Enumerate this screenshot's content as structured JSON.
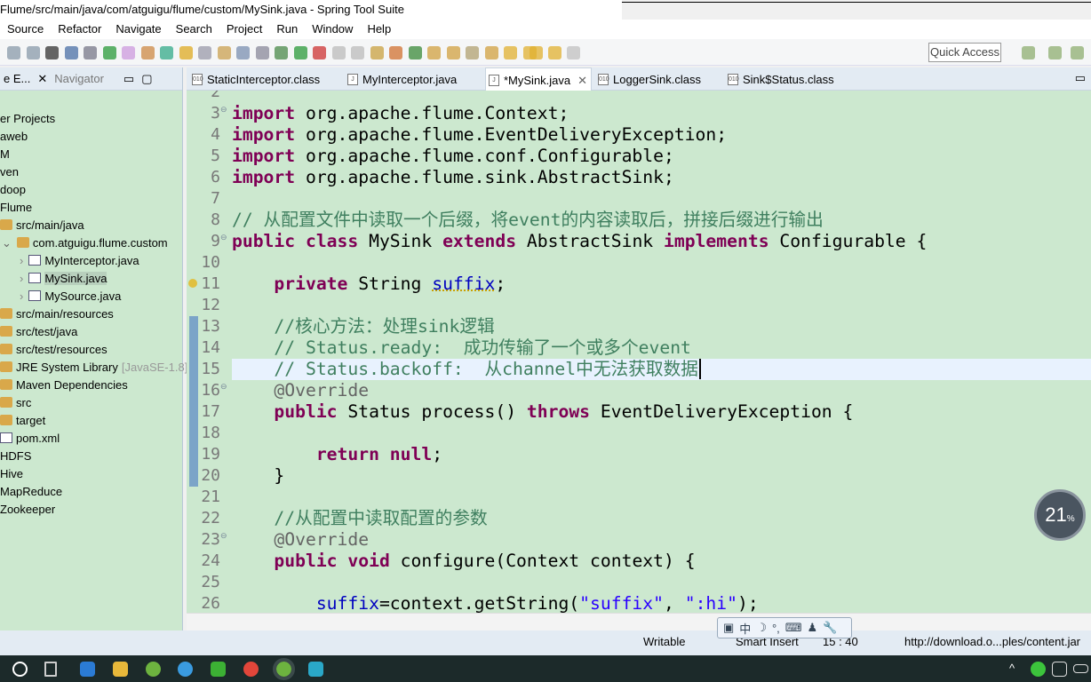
{
  "window": {
    "title": "Flume/src/main/java/com/atguigu/flume/custom/MySink.java - Spring Tool Suite"
  },
  "menu": [
    "Source",
    "Refactor",
    "Navigate",
    "Search",
    "Project",
    "Run",
    "Window",
    "Help"
  ],
  "toolbar": {
    "quick_access": "Quick Access"
  },
  "left_panel": {
    "tabs": [
      "e E...",
      "Navigator"
    ],
    "tree": [
      {
        "label": "er Projects",
        "indent": 0
      },
      {
        "label": "aweb",
        "indent": 0
      },
      {
        "label": "M",
        "indent": 0
      },
      {
        "label": "ven",
        "indent": 0
      },
      {
        "label": "doop",
        "indent": 0
      },
      {
        "label": "Flume",
        "indent": 0
      },
      {
        "label": "src/main/java",
        "indent": 1,
        "icon": "package-folder-icon"
      },
      {
        "label": "com.atguigu.flume.custom",
        "indent": 2,
        "icon": "package-icon",
        "expanded": true
      },
      {
        "label": "MyInterceptor.java",
        "indent": 3,
        "icon": "java-file-icon"
      },
      {
        "label": "MySink.java",
        "indent": 3,
        "icon": "java-file-warning-icon",
        "selected": true
      },
      {
        "label": "MySource.java",
        "indent": 3,
        "icon": "java-file-icon"
      },
      {
        "label": "src/main/resources",
        "indent": 1,
        "icon": "package-folder-icon"
      },
      {
        "label": "src/test/java",
        "indent": 1,
        "icon": "package-folder-icon"
      },
      {
        "label": "src/test/resources",
        "indent": 1,
        "icon": "package-folder-icon"
      },
      {
        "label": "JRE System Library",
        "suffix": "[JavaSE-1.8]",
        "indent": 1,
        "icon": "library-icon"
      },
      {
        "label": "Maven Dependencies",
        "indent": 1,
        "icon": "library-icon"
      },
      {
        "label": "src",
        "indent": 1,
        "icon": "folder-icon"
      },
      {
        "label": "target",
        "indent": 1,
        "icon": "folder-icon"
      },
      {
        "label": "pom.xml",
        "indent": 1,
        "icon": "maven-file-icon"
      },
      {
        "label": "HDFS",
        "indent": 0
      },
      {
        "label": "Hive",
        "indent": 0
      },
      {
        "label": "MapReduce",
        "indent": 0
      },
      {
        "label": "Zookeeper",
        "indent": 0
      }
    ]
  },
  "editor_tabs": [
    {
      "label": "StaticInterceptor.class",
      "icon": "class-file-icon"
    },
    {
      "label": "MyInterceptor.java",
      "icon": "java-file-icon"
    },
    {
      "label": "*MySink.java",
      "icon": "java-file-icon",
      "active": true
    },
    {
      "label": "LoggerSink.class",
      "icon": "class-file-icon"
    },
    {
      "label": "Sink$Status.class",
      "icon": "class-file-icon"
    }
  ],
  "editor": {
    "current_line": 15,
    "lines": [
      {
        "n": "2",
        "t": []
      },
      {
        "n": "3",
        "t": [
          [
            "kw",
            "import"
          ],
          [
            "pl",
            " org.apache.flume.Context;"
          ]
        ]
      },
      {
        "n": "4",
        "t": [
          [
            "kw",
            "import"
          ],
          [
            "pl",
            " org.apache.flume.EventDeliveryException;"
          ]
        ]
      },
      {
        "n": "5",
        "t": [
          [
            "kw",
            "import"
          ],
          [
            "pl",
            " org.apache.flume.conf.Configurable;"
          ]
        ]
      },
      {
        "n": "6",
        "t": [
          [
            "kw",
            "import"
          ],
          [
            "pl",
            " org.apache.flume.sink.AbstractSink;"
          ]
        ]
      },
      {
        "n": "7",
        "t": []
      },
      {
        "n": "8",
        "t": [
          [
            "cm",
            "// 从配置文件中读取一个后缀，将event的内容读取后，拼接后缀进行输出"
          ]
        ]
      },
      {
        "n": "9",
        "t": [
          [
            "kw",
            "public class"
          ],
          [
            "pl",
            " MySink "
          ],
          [
            "kw",
            "extends"
          ],
          [
            "pl",
            " AbstractSink "
          ],
          [
            "kw",
            "implements"
          ],
          [
            "pl",
            " Configurable {"
          ]
        ]
      },
      {
        "n": "10",
        "t": []
      },
      {
        "n": "11",
        "t": [
          [
            "pl",
            "    "
          ],
          [
            "kw",
            "private"
          ],
          [
            "pl",
            " String "
          ],
          [
            "fld",
            "suffix"
          ],
          [
            "pl",
            ";"
          ]
        ]
      },
      {
        "n": "12",
        "t": []
      },
      {
        "n": "13",
        "t": [
          [
            "pl",
            "    "
          ],
          [
            "cm",
            "//核心方法：处理sink逻辑"
          ]
        ]
      },
      {
        "n": "14",
        "t": [
          [
            "pl",
            "    "
          ],
          [
            "cm",
            "// Status.ready:  成功传输了一个或多个event"
          ]
        ]
      },
      {
        "n": "15",
        "t": [
          [
            "pl",
            "    "
          ],
          [
            "cm",
            "// Status.backoff:  从channel中无法获取数据"
          ]
        ]
      },
      {
        "n": "16",
        "t": [
          [
            "pl",
            "    "
          ],
          [
            "ann",
            "@Override"
          ]
        ]
      },
      {
        "n": "17",
        "t": [
          [
            "pl",
            "    "
          ],
          [
            "kw",
            "public"
          ],
          [
            "pl",
            " Status process() "
          ],
          [
            "kw",
            "throws"
          ],
          [
            "pl",
            " EventDeliveryException {"
          ]
        ]
      },
      {
        "n": "18",
        "t": []
      },
      {
        "n": "19",
        "t": [
          [
            "pl",
            "        "
          ],
          [
            "kw",
            "return null"
          ],
          [
            "pl",
            ";"
          ]
        ]
      },
      {
        "n": "20",
        "t": [
          [
            "pl",
            "    }"
          ]
        ]
      },
      {
        "n": "21",
        "t": []
      },
      {
        "n": "22",
        "t": [
          [
            "pl",
            "    "
          ],
          [
            "cm",
            "//从配置中读取配置的参数"
          ]
        ]
      },
      {
        "n": "23",
        "t": [
          [
            "pl",
            "    "
          ],
          [
            "ann",
            "@Override"
          ]
        ]
      },
      {
        "n": "24",
        "t": [
          [
            "pl",
            "    "
          ],
          [
            "kw",
            "public void"
          ],
          [
            "pl",
            " configure(Context "
          ],
          [
            "pl",
            "context"
          ],
          [
            "pl",
            ") {"
          ]
        ]
      },
      {
        "n": "25",
        "t": []
      },
      {
        "n": "26",
        "t": [
          [
            "pl",
            "        "
          ],
          [
            "fld",
            "suffix"
          ],
          [
            "pl",
            "=context.getString("
          ],
          [
            "str",
            "\"suffix\""
          ],
          [
            "pl",
            ", "
          ],
          [
            "str",
            "\":hi\""
          ],
          [
            "pl",
            ");"
          ]
        ]
      }
    ]
  },
  "status": {
    "writable": "Writable",
    "insert_mode": "Smart Insert",
    "position": "15 : 40",
    "url": "http://download.o...ples/content.jar"
  },
  "ime": {
    "lang": "中"
  },
  "badge": {
    "value": "21",
    "unit": "%"
  },
  "colors": {
    "editor_bg": "#cce8cf",
    "keyword": "#7f0055",
    "comment": "#3f7f5f",
    "string": "#2a00ff",
    "field": "#0000c0"
  }
}
